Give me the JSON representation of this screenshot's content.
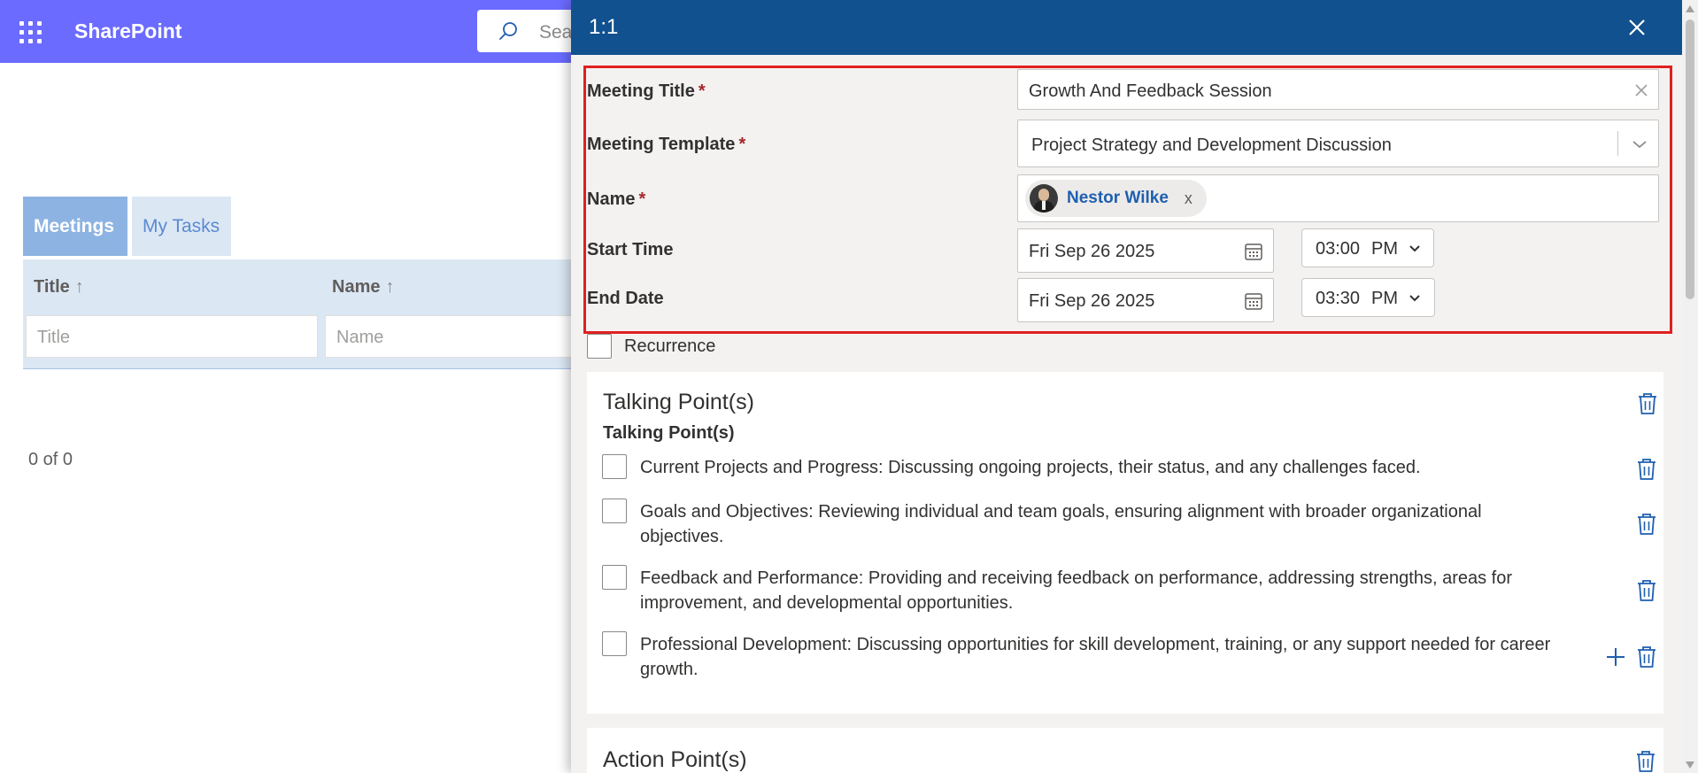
{
  "app": {
    "brand": "SharePoint",
    "search_placeholder": "Sea",
    "brand_color": "#6b6bff"
  },
  "background_page": {
    "tabs": [
      {
        "label": "Meetings",
        "active": true
      },
      {
        "label": "My Tasks",
        "active": false
      }
    ],
    "columns": [
      {
        "label": "Title",
        "sort": "↑",
        "filter_placeholder": "Title"
      },
      {
        "label": "Name",
        "sort": "↑",
        "filter_placeholder": "Name"
      }
    ],
    "paging": "0 of 0"
  },
  "panel": {
    "title": "1:1",
    "header_color": "#11518f",
    "form": {
      "meeting_title": {
        "label": "Meeting Title",
        "required": "*",
        "value": "Growth And Feedback Session"
      },
      "meeting_template": {
        "label": "Meeting Template",
        "required": "*",
        "value": "Project Strategy and Development Discussion"
      },
      "name": {
        "label": "Name",
        "required": "*",
        "person": "Nestor Wilke",
        "remove": "x"
      },
      "start_time": {
        "label": "Start Time",
        "date": "Fri Sep 26 2025",
        "time": "03:00",
        "ampm": "PM"
      },
      "end_date": {
        "label": "End Date",
        "date": "Fri Sep 26 2025",
        "time": "03:30",
        "ampm": "PM"
      },
      "recurrence": {
        "label": "Recurrence",
        "checked": false
      }
    },
    "talking_points": {
      "title": "Talking Point(s)",
      "subtitle": "Talking Point(s)",
      "items": [
        {
          "text": "Current Projects and Progress:  Discussing ongoing projects, their status, and any challenges faced."
        },
        {
          "text": "Goals and Objectives:  Reviewing individual and team goals, ensuring alignment with broader organizational objectives."
        },
        {
          "text": "Feedback and Performance:  Providing and receiving feedback on performance, addressing strengths, areas for improvement, and developmental opportunities."
        },
        {
          "text": "Professional Development:  Discussing opportunities for skill development, training, or any support needed for career growth."
        }
      ]
    },
    "action_points": {
      "title": "Action Point(s)"
    }
  },
  "icons": [
    "waffle-icon",
    "search-icon",
    "close-icon",
    "clear-icon",
    "chevron-down-icon",
    "calendar-icon",
    "trash-icon",
    "plus-icon"
  ]
}
